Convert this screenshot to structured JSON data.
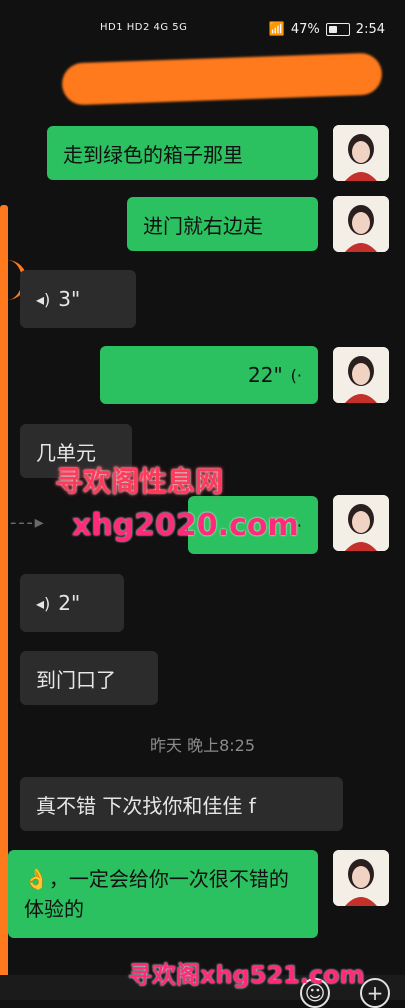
{
  "status_bar": {
    "left": "HD1 HD2 4G 5G",
    "battery": "47%",
    "time": "2:54"
  },
  "messages": [
    {
      "side": "right",
      "text": "走到绿色的箱子那里"
    },
    {
      "side": "right",
      "text": "进门就右边走"
    },
    {
      "side": "left",
      "voice": "3\""
    },
    {
      "side": "right",
      "voice": "22\""
    },
    {
      "side": "left",
      "text": "几单元"
    },
    {
      "side": "right",
      "voice": "...\""
    },
    {
      "side": "left",
      "voice": "2\""
    },
    {
      "side": "left",
      "text": "到门口了"
    },
    {
      "side": "left",
      "text": "真不错 下次找你和佳佳 f"
    },
    {
      "side": "right",
      "text": "👌，一定会给你一次很不错的体验的"
    }
  ],
  "timestamp": "昨天 晚上8:25",
  "watermarks": [
    "寻欢阁性息网",
    "xhg2020.com",
    "寻欢阁xhg521.com"
  ],
  "icons": {
    "emoji": "smiley-icon",
    "plus": "plus-icon"
  }
}
